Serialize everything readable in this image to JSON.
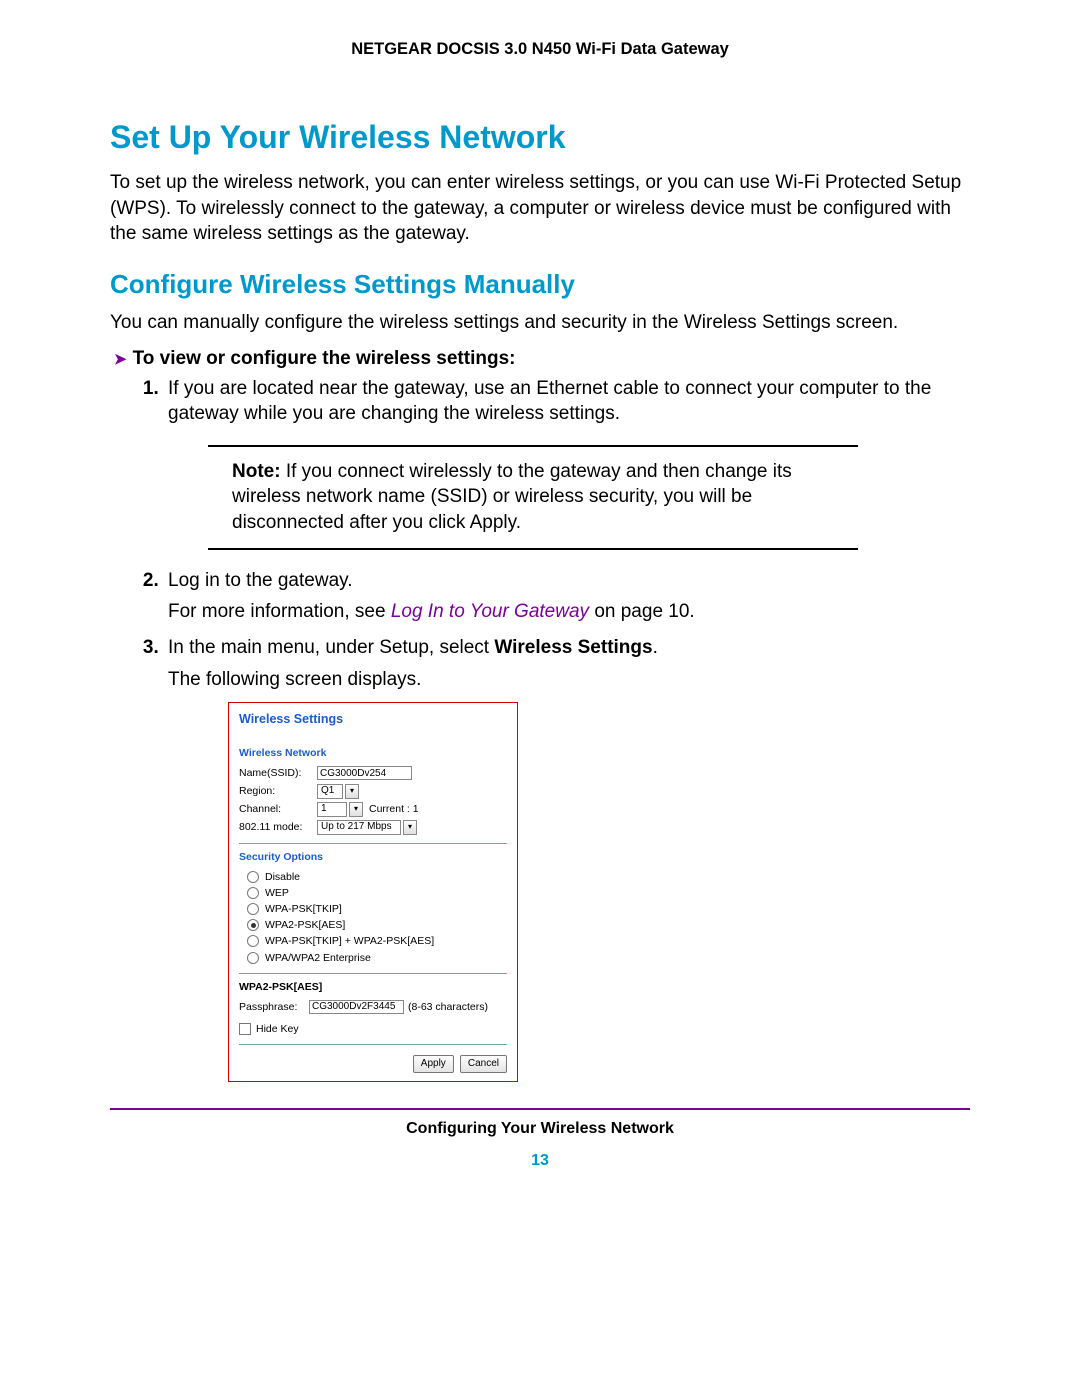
{
  "header": "NETGEAR DOCSIS 3.0 N450 Wi-Fi Data Gateway",
  "h1": "Set Up Your Wireless Network",
  "intro": "To set up the wireless network, you can enter wireless settings, or you can use Wi-Fi Protected Setup (WPS). To wirelessly connect to the gateway, a computer or wireless device must be configured with the same wireless settings as the gateway.",
  "h2": "Configure Wireless Settings Manually",
  "h2_intro": "You can manually configure the wireless settings and security in the Wireless Settings screen.",
  "proc_title": "To view or configure the wireless settings:",
  "steps": {
    "s1": "If you are located near the gateway, use an Ethernet cable to connect your computer to the gateway while you are changing the wireless settings.",
    "note_label": "Note:",
    "note_body": "If you connect wirelessly to the gateway and then change its wireless network name (SSID) or wireless security, you will be disconnected after you click Apply.",
    "s2a": "Log in to the gateway.",
    "s2b_pre": "For more information, see ",
    "s2b_link": "Log In to Your Gateway",
    "s2b_post": " on page 10.",
    "s3a_pre": "In the main menu, under Setup, select ",
    "s3a_bold": "Wireless Settings",
    "s3a_post": ".",
    "s3b": "The following screen displays."
  },
  "ui": {
    "title": "Wireless Settings",
    "net_section": "Wireless Network",
    "name_lbl": "Name(SSID):",
    "name_val": "CG3000Dv254",
    "region_lbl": "Region:",
    "region_val": "Q1",
    "channel_lbl": "Channel:",
    "channel_val": "1",
    "channel_cur": "Current : 1",
    "mode_lbl": "802.11 mode:",
    "mode_val": "Up to 217 Mbps",
    "sec_section": "Security Options",
    "opts": [
      "Disable",
      "WEP",
      "WPA-PSK[TKIP]",
      "WPA2-PSK[AES]",
      "WPA-PSK[TKIP] + WPA2-PSK[AES]",
      "WPA/WPA2 Enterprise"
    ],
    "selected_option_index": 3,
    "wpa_section": "WPA2-PSK[AES]",
    "pass_lbl": "Passphrase:",
    "pass_val": "CG3000Dv2F3445",
    "pass_hint": "(8-63 characters)",
    "hidekey": "Hide Key",
    "apply": "Apply",
    "cancel": "Cancel"
  },
  "footer": "Configuring Your Wireless Network",
  "page_num": "13"
}
